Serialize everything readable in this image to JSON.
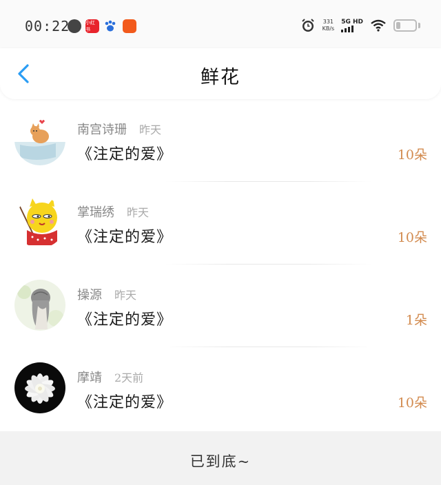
{
  "status_bar": {
    "time": "00:22",
    "app_badge_text": "小红书",
    "net_speed_value": "331",
    "net_speed_unit": "KB/s",
    "network_type": "5G HD",
    "icons": [
      "globe-icon",
      "xiaohongshu-icon",
      "baidu-paw-icon",
      "video-app-icon",
      "alarm-icon",
      "signal-icon",
      "wifi-icon",
      "battery-icon"
    ]
  },
  "header": {
    "title": "鲜花",
    "back_icon": "chevron-left-icon",
    "accent_color": "#2a9df4"
  },
  "items": [
    {
      "name": "南宫诗珊",
      "time": "昨天",
      "title": "《注定的爱》",
      "count": "10朵",
      "avatar": "cartoon-cat-avatar"
    },
    {
      "name": "掌瑞绣",
      "time": "昨天",
      "title": "《注定的爱》",
      "count": "10朵",
      "avatar": "yellow-cartoon-avatar"
    },
    {
      "name": "操源",
      "time": "昨天",
      "title": "《注定的爱》",
      "count": "1朵",
      "avatar": "girl-illustration-avatar"
    },
    {
      "name": "摩靖",
      "time": "2天前",
      "title": "《注定的爱》",
      "count": "10朵",
      "avatar": "white-flower-avatar"
    }
  ],
  "footer": {
    "text": "已到底~"
  },
  "colors": {
    "count": "#d28a4e",
    "name": "#888888",
    "footer_bg": "#f2f2f2"
  }
}
